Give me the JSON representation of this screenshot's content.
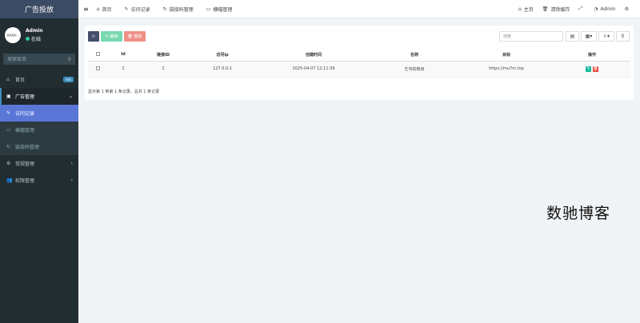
{
  "sidebar": {
    "title": "广告投放",
    "user": {
      "avatar_text": "肌肤更新...",
      "name": "Admin",
      "status": "在线"
    },
    "search_placeholder": "搜索菜单",
    "items": [
      {
        "label": "首页",
        "badge": "hot"
      },
      {
        "label": "广告管理"
      },
      {
        "label": "访问记录"
      },
      {
        "label": "横幅管理"
      },
      {
        "label": "链接码管理"
      },
      {
        "label": "常规管理"
      },
      {
        "label": "权限管理"
      }
    ]
  },
  "topbar": {
    "tabs": [
      {
        "label": "首页"
      },
      {
        "label": "访问记录"
      },
      {
        "label": "链接码管理"
      },
      {
        "label": "横幅管理"
      }
    ],
    "right": {
      "home": "主页",
      "clear_cache": "清除缓存",
      "user": "Admin"
    }
  },
  "toolbar": {
    "edit_label": "编辑",
    "delete_label": "删除",
    "search_placeholder": "搜索"
  },
  "table": {
    "headers": [
      "Id",
      "链接ID",
      "访问ip",
      "创建时间",
      "名称",
      "目标",
      "操作"
    ],
    "rows": [
      {
        "id": "1",
        "link_id": "1",
        "ip": "127.0.0.1",
        "created": "2025-04-07 12:11:39",
        "name": "乞丐的琐目",
        "target": "https://mu7m.top"
      }
    ]
  },
  "pagination_info": "显示第 1 到第 1 条记录，总共 1 条记录",
  "watermark": "数驰博客",
  "colors": {
    "sidebar_bg": "#222d32",
    "active_menu": "#5a77d8",
    "edit_btn": "#18bc9c",
    "delete_btn": "#e74c3c"
  }
}
